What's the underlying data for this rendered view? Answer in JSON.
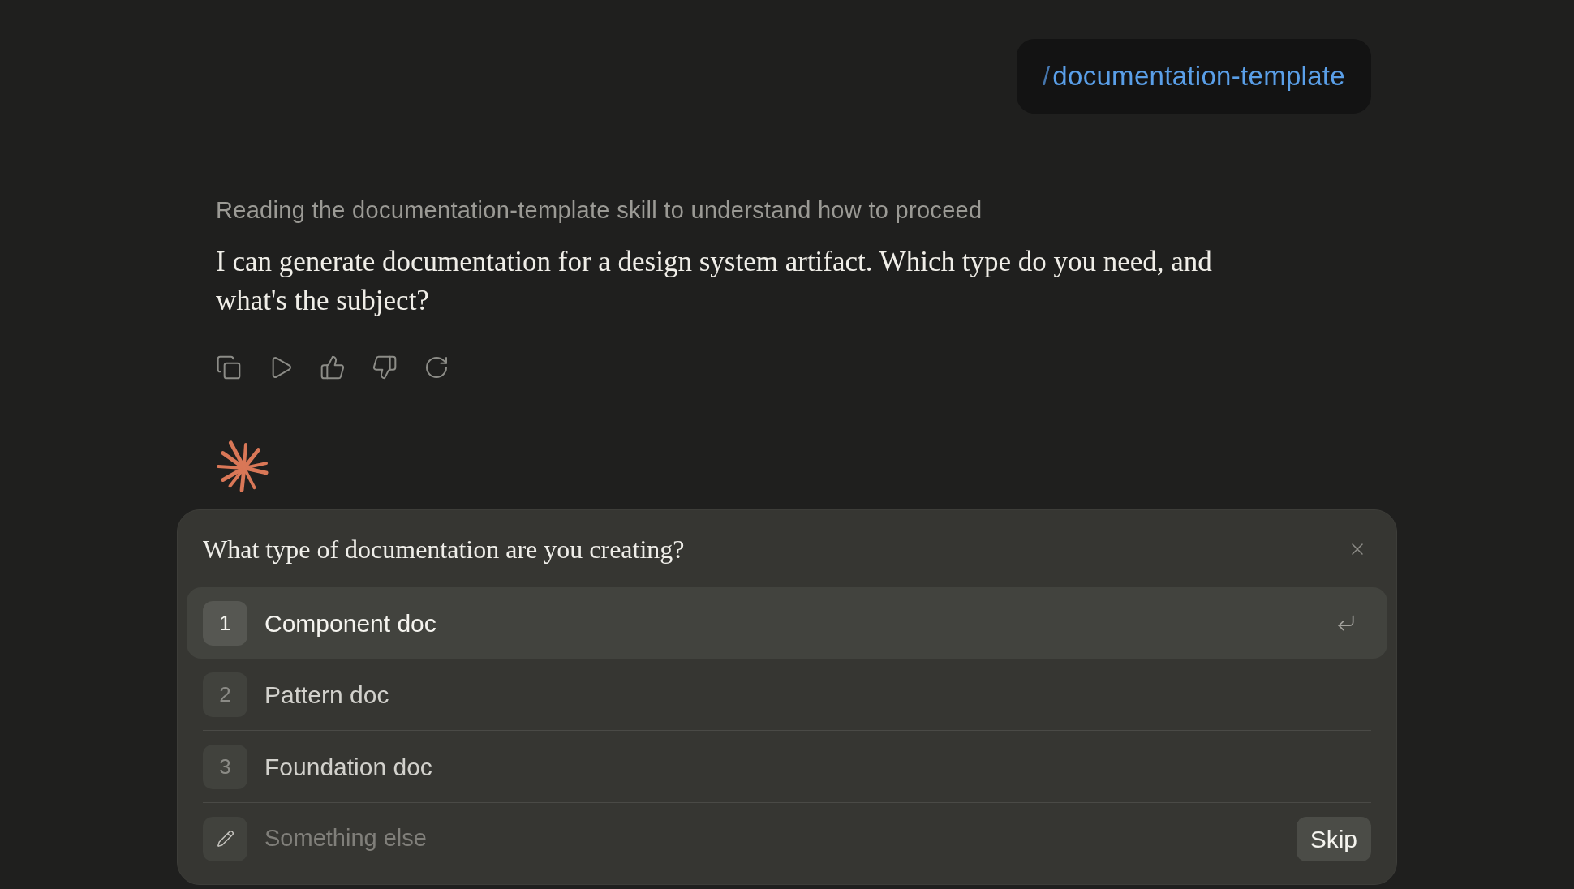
{
  "user_message": {
    "prefix": "/",
    "command": "documentation-template"
  },
  "assistant": {
    "status": "Reading the documentation-template skill to understand how to proceed",
    "message": "I can generate documentation for a design system artifact. Which type do you need, and what's the subject?"
  },
  "question_panel": {
    "question": "What type of documentation are you creating?",
    "options": [
      {
        "key": "1",
        "label": "Component doc",
        "selected": true
      },
      {
        "key": "2",
        "label": "Pattern doc",
        "selected": false
      },
      {
        "key": "3",
        "label": "Foundation doc",
        "selected": false
      }
    ],
    "custom_answer": {
      "placeholder": "Something else"
    },
    "skip_button": "Skip"
  }
}
